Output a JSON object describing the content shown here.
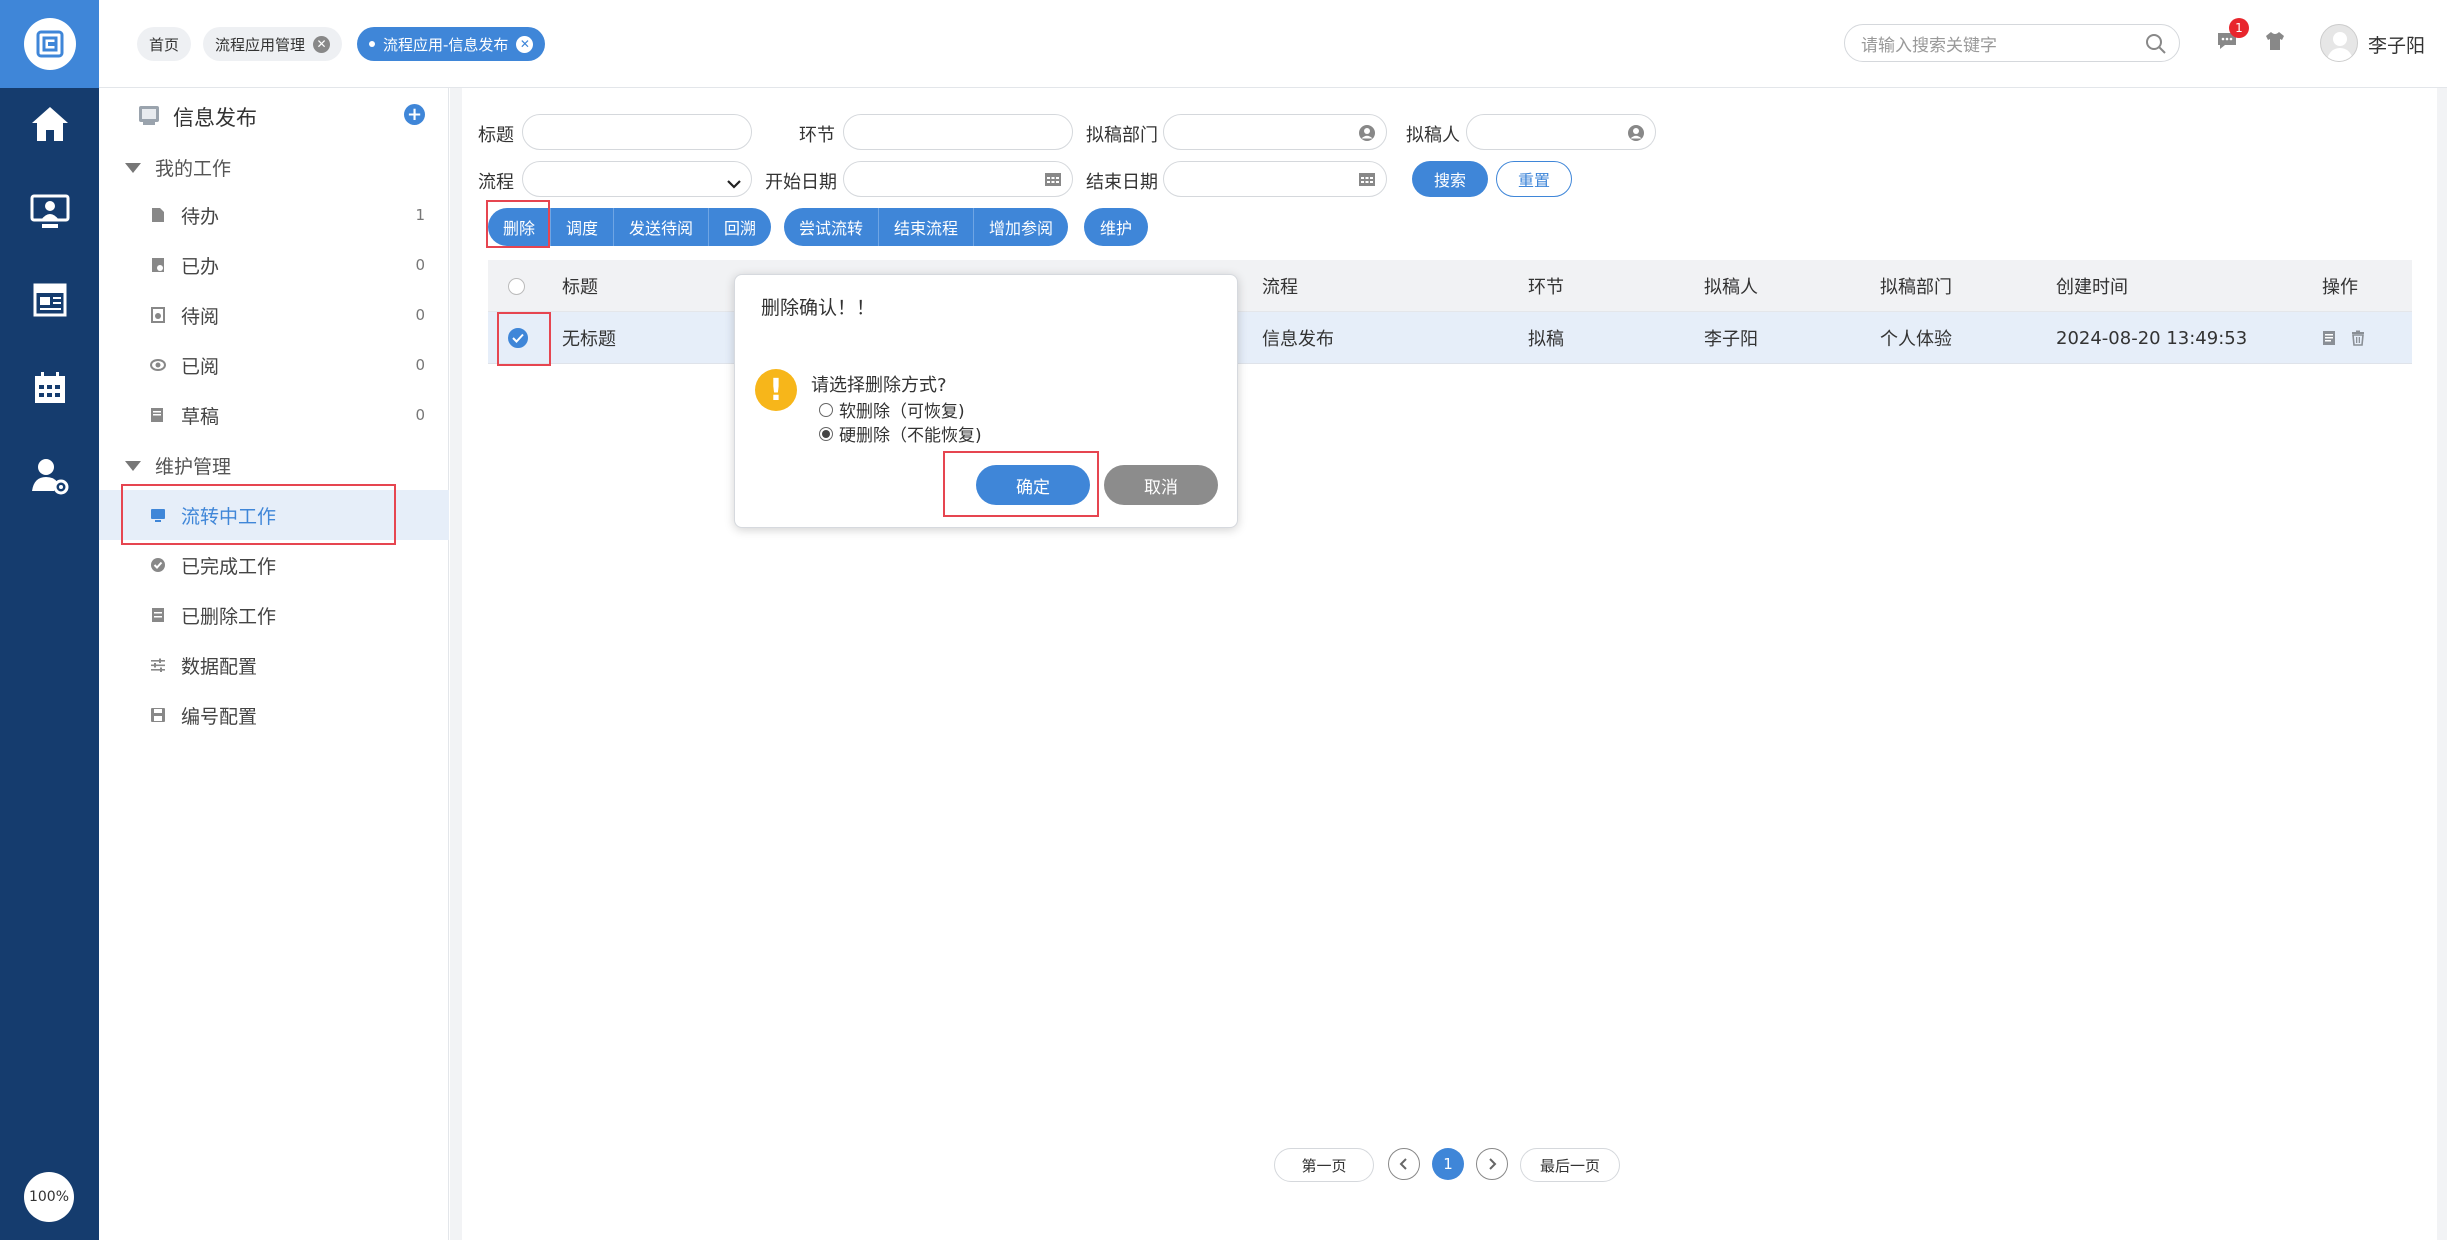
{
  "rail": {
    "zoom": "100%",
    "icons": [
      "logo-icon",
      "home-icon",
      "monitor-user-icon",
      "news-icon",
      "calendar-icon",
      "user-settings-icon"
    ]
  },
  "tabs": [
    {
      "label": "首页"
    },
    {
      "label": "流程应用管理"
    },
    {
      "label": "流程应用-信息发布"
    }
  ],
  "search": {
    "placeholder": "请输入搜索关键字"
  },
  "header": {
    "message_count": "1",
    "username": "李子阳"
  },
  "sidebar": {
    "title": "信息发布",
    "groups": [
      {
        "label": "我的工作"
      },
      {
        "label": "维护管理"
      }
    ],
    "items": [
      {
        "label": "待办",
        "count": "1"
      },
      {
        "label": "已办",
        "count": "0"
      },
      {
        "label": "待阅",
        "count": "0"
      },
      {
        "label": "已阅",
        "count": "0"
      },
      {
        "label": "草稿",
        "count": "0"
      },
      {
        "label": "流转中工作"
      },
      {
        "label": "已完成工作"
      },
      {
        "label": "已删除工作"
      },
      {
        "label": "数据配置"
      },
      {
        "label": "编号配置"
      }
    ]
  },
  "filters": {
    "title": "标题",
    "node": "环节",
    "dept": "拟稿部门",
    "drafter": "拟稿人",
    "process": "流程",
    "start_date": "开始日期",
    "end_date": "结束日期",
    "search_btn": "搜索",
    "reset_btn": "重置"
  },
  "toolbar": {
    "group1": [
      "删除",
      "调度",
      "发送待阅",
      "回溯"
    ],
    "group2": [
      "尝试流转",
      "结束流程",
      "增加参阅"
    ],
    "maintain": "维护"
  },
  "table": {
    "headers": [
      "标题",
      "流程",
      "环节",
      "拟稿人",
      "拟稿部门",
      "创建时间",
      "操作"
    ],
    "rows": [
      {
        "title": "无标题",
        "process": "信息发布",
        "node": "拟稿",
        "drafter": "李子阳",
        "dept": "个人体验",
        "created": "2024-08-20 13:49:53"
      }
    ]
  },
  "pager": {
    "first": "第一页",
    "current": "1",
    "last": "最后一页"
  },
  "dialog": {
    "title": "删除确认！！",
    "question": "请选择删除方式?",
    "options": [
      "软删除（可恢复)",
      "硬删除（不能恢复)"
    ],
    "selected_index": 1,
    "ok": "确定",
    "cancel": "取消"
  },
  "colors": {
    "accent": "#3f86d8",
    "rail": "#153c6e",
    "highlight": "#e64550",
    "warning": "#f7b61a"
  }
}
